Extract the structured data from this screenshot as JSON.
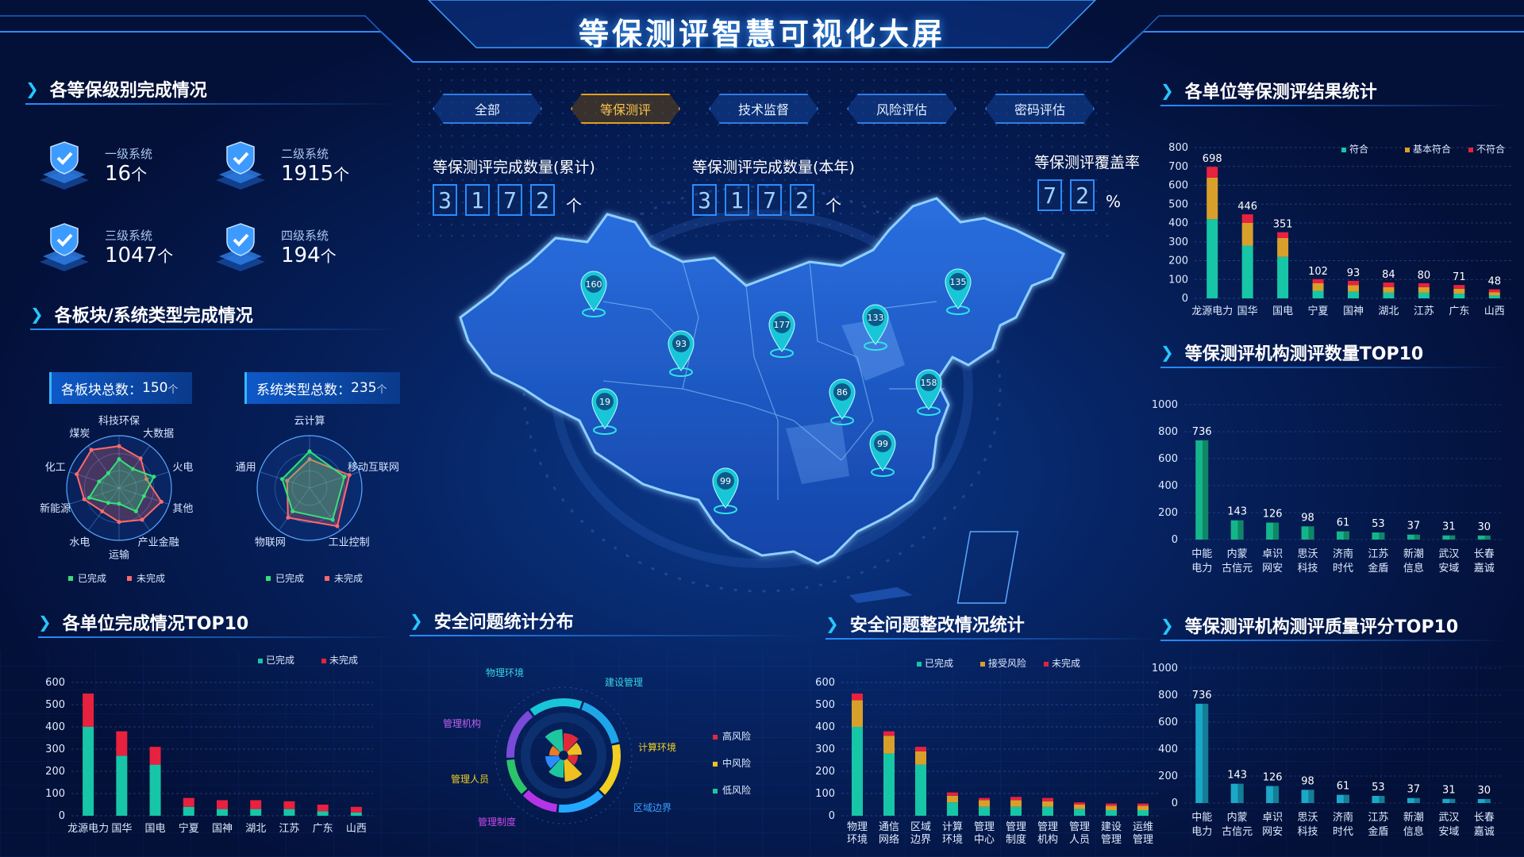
{
  "title": "等保测评智慧可视化大屏",
  "tabs": [
    "全部",
    "等保测评",
    "技术监督",
    "风险评估",
    "密码评估"
  ],
  "stats": {
    "cum": {
      "label": "等保测评完成数量(累计)",
      "digits": [
        "3",
        "1",
        "7",
        "2"
      ],
      "unit": "个"
    },
    "year": {
      "label": "等保测评完成数量(本年)",
      "digits": [
        "3",
        "1",
        "7",
        "2"
      ],
      "unit": "个"
    },
    "cover": {
      "label": "等保测评覆盖率",
      "digits": [
        "7",
        "2"
      ],
      "unit": "%"
    }
  },
  "levels": {
    "title": "各等保级别完成情况",
    "items": [
      {
        "label": "一级系统",
        "value": "16",
        "unit": "个"
      },
      {
        "label": "二级系统",
        "value": "1915",
        "unit": "个"
      },
      {
        "label": "三级系统",
        "value": "1047",
        "unit": "个"
      },
      {
        "label": "四级系统",
        "value": "194",
        "unit": "个"
      }
    ]
  },
  "blocks": {
    "title": "各板块/系统类型完成情况",
    "box1": {
      "label": "各板块总数：",
      "value": "150",
      "unit": "个"
    },
    "box2": {
      "label": "系统类型总数：",
      "value": "235",
      "unit": "个"
    },
    "radar1": {
      "axes": [
        "科技环保",
        "大数据",
        "火电",
        "其他",
        "产业金融",
        "运输",
        "水电",
        "新能源",
        "化工",
        "煤炭"
      ],
      "done": [
        0.55,
        0.45,
        0.7,
        0.5,
        0.55,
        0.3,
        0.35,
        0.6,
        0.4,
        0.35
      ],
      "undone": [
        0.8,
        0.7,
        0.55,
        0.85,
        0.75,
        0.65,
        0.55,
        0.7,
        0.85,
        0.9
      ]
    },
    "radar2": {
      "axes": [
        "云计算",
        "移动互联网",
        "工业控制",
        "物联网",
        "通用"
      ],
      "done": [
        0.7,
        0.7,
        0.75,
        0.55,
        0.55
      ],
      "undone": [
        0.55,
        0.8,
        0.9,
        0.7,
        0.45
      ]
    },
    "legend": {
      "done": "已完成",
      "undone": "未完成"
    }
  },
  "top10": {
    "title": "各单位完成情况TOP10",
    "legend": [
      "已完成",
      "未完成"
    ],
    "categories": [
      "龙源电力",
      "国华",
      "国电",
      "宁夏",
      "国神",
      "湖北",
      "江苏",
      "广东",
      "山西"
    ]
  },
  "issues": {
    "title": "安全问题统计分布",
    "labels": [
      "物理环境",
      "建设管理",
      "计算环境",
      "区域边界",
      "管理制度",
      "管理人员",
      "管理机构"
    ],
    "legend": [
      "高风险",
      "中风险",
      "低风险"
    ]
  },
  "rectify": {
    "title": "安全问题整改情况统计",
    "legend": [
      "已完成",
      "接受风险",
      "未完成"
    ],
    "categories": [
      "物理环境",
      "通信网络",
      "区域边界",
      "计算环境",
      "管理中心",
      "管理制度",
      "管理机构",
      "管理人员",
      "建设管理",
      "运维管理"
    ]
  },
  "results": {
    "title": "各单位等保测评结果统计",
    "legend": [
      "符合",
      "基本符合",
      "不符合"
    ],
    "categories": [
      "龙源电力",
      "国华",
      "国电",
      "宁夏",
      "国神",
      "湖北",
      "江苏",
      "广东",
      "山西"
    ],
    "totals": [
      "698",
      "446",
      "351",
      "102",
      "93",
      "84",
      "80",
      "71",
      "48"
    ]
  },
  "orgcount": {
    "title": "等保测评机构测评数量TOP10",
    "categories": [
      "中能电力",
      "内蒙古信元",
      "卓识网安",
      "思沃科技",
      "济南时代",
      "江苏金盾",
      "新潮信息",
      "武汉安域",
      "长春嘉诚"
    ],
    "values": [
      "736",
      "143",
      "126",
      "98",
      "61",
      "53",
      "37",
      "31",
      "30"
    ]
  },
  "orgscore": {
    "title": "等保测评机构测评质量评分TOP10",
    "categories": [
      "中能电力",
      "内蒙古信元",
      "卓识网安",
      "思沃科技",
      "济南时代",
      "江苏金盾",
      "新潮信息",
      "武汉安域",
      "长春嘉诚"
    ],
    "values": [
      "736",
      "143",
      "126",
      "98",
      "61",
      "53",
      "37",
      "31",
      "30"
    ]
  },
  "map_pins": [
    "160",
    "93",
    "177",
    "133",
    "135",
    "19",
    "86",
    "158",
    "99",
    "99"
  ],
  "chart_data": [
    {
      "type": "bar",
      "title": "各单位完成情况TOP10",
      "categories": [
        "龙源电力",
        "国华",
        "国电",
        "宁夏",
        "国神",
        "湖北",
        "江苏",
        "广东",
        "山西"
      ],
      "ylim": [
        0,
        600
      ],
      "yticks": [
        0,
        100,
        200,
        300,
        400,
        500,
        600
      ],
      "series": [
        {
          "name": "已完成",
          "values": [
            400,
            270,
            230,
            40,
            30,
            30,
            30,
            20,
            15
          ]
        },
        {
          "name": "未完成",
          "values": [
            150,
            110,
            80,
            40,
            40,
            40,
            35,
            30,
            25
          ]
        }
      ]
    },
    {
      "type": "bar",
      "title": "安全问题整改情况统计",
      "categories": [
        "物理环境",
        "通信网络",
        "区域边界",
        "计算环境",
        "管理中心",
        "管理制度",
        "管理机构",
        "管理人员",
        "建设管理",
        "运维管理"
      ],
      "ylim": [
        0,
        600
      ],
      "yticks": [
        0,
        100,
        200,
        300,
        400,
        500,
        600
      ],
      "series": [
        {
          "name": "已完成",
          "values": [
            400,
            280,
            230,
            60,
            40,
            40,
            40,
            30,
            25,
            25
          ]
        },
        {
          "name": "接受风险",
          "values": [
            120,
            80,
            60,
            30,
            30,
            30,
            25,
            20,
            20,
            20
          ]
        },
        {
          "name": "未完成",
          "values": [
            30,
            20,
            20,
            15,
            10,
            15,
            15,
            10,
            10,
            10
          ]
        }
      ]
    },
    {
      "type": "bar",
      "title": "各单位等保测评结果统计",
      "categories": [
        "龙源电力",
        "国华",
        "国电",
        "宁夏",
        "国神",
        "湖北",
        "江苏",
        "广东",
        "山西"
      ],
      "ylim": [
        0,
        800
      ],
      "yticks": [
        0,
        100,
        200,
        300,
        400,
        500,
        600,
        700,
        800
      ],
      "series": [
        {
          "name": "符合",
          "values": [
            420,
            280,
            220,
            40,
            35,
            30,
            30,
            25,
            15
          ]
        },
        {
          "name": "基本符合",
          "values": [
            220,
            120,
            100,
            40,
            35,
            30,
            30,
            26,
            18
          ]
        },
        {
          "name": "不符合",
          "values": [
            58,
            46,
            31,
            22,
            23,
            24,
            20,
            20,
            15
          ]
        }
      ]
    },
    {
      "type": "bar",
      "title": "等保测评机构测评数量TOP10",
      "categories": [
        "中能电力",
        "内蒙古信元",
        "卓识网安",
        "思沃科技",
        "济南时代",
        "江苏金盾",
        "新潮信息",
        "武汉安域",
        "长春嘉诚"
      ],
      "ylim": [
        0,
        1000
      ],
      "yticks": [
        0,
        200,
        400,
        600,
        800,
        1000
      ],
      "values": [
        736,
        143,
        126,
        98,
        61,
        53,
        37,
        31,
        30
      ]
    },
    {
      "type": "bar",
      "title": "等保测评机构测评质量评分TOP10",
      "categories": [
        "中能电力",
        "内蒙古信元",
        "卓识网安",
        "思沃科技",
        "济南时代",
        "江苏金盾",
        "新潮信息",
        "武汉安域",
        "长春嘉诚"
      ],
      "ylim": [
        0,
        1000
      ],
      "yticks": [
        0,
        200,
        400,
        600,
        800,
        1000
      ],
      "values": [
        736,
        143,
        126,
        98,
        61,
        53,
        37,
        31,
        30
      ]
    }
  ]
}
